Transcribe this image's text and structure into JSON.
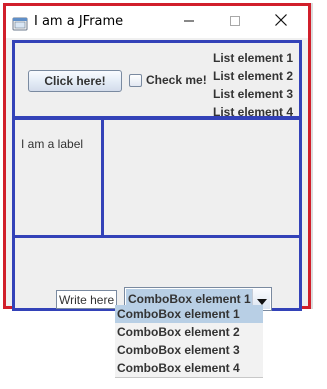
{
  "window": {
    "title": "I am a JFrame",
    "controls": {
      "minimize_icon": "minimize-icon",
      "maximize_icon": "maximize-icon",
      "close_icon": "close-icon"
    }
  },
  "top_panel": {
    "button_label": "Click here!",
    "checkbox_label": "Check me!",
    "checkbox_checked": false,
    "list_items": [
      "List element 1",
      "List element 2",
      "List element 3",
      "List element 4"
    ]
  },
  "left_panel": {
    "label": "I am a label"
  },
  "bottom_panel": {
    "textfield_value": "Write here!",
    "combobox_selected": "ComboBox element 1",
    "combobox_options": [
      "ComboBox element 1",
      "ComboBox element 2",
      "ComboBox element 3",
      "ComboBox element 4"
    ]
  },
  "colors": {
    "frame_border": "#d11f2b",
    "panel_border": "#3342b8",
    "selection": "#b8cfe5"
  }
}
